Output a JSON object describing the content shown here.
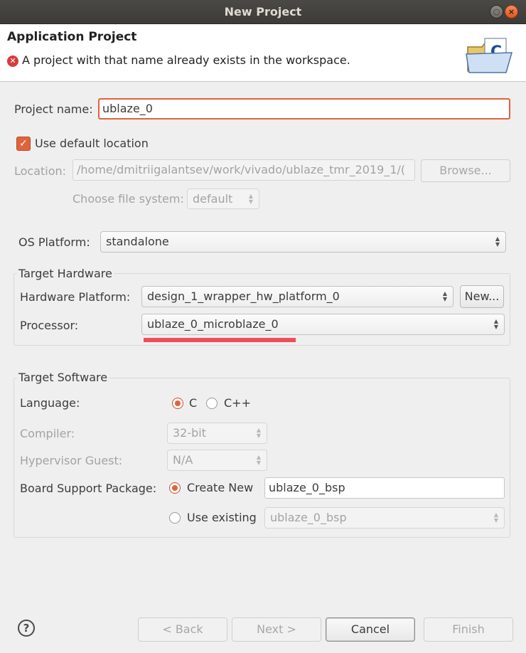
{
  "window": {
    "title": "New Project",
    "minimize_glyph": "○",
    "close_glyph": "×"
  },
  "banner": {
    "title": "Application Project",
    "error_message": "A project with that name already exists in the workspace.",
    "error_icon": "error-circle-icon",
    "wizard_icon": "c-project-folder-icon",
    "colors": {
      "error": "#d83b3b"
    }
  },
  "project": {
    "name_label": "Project name:",
    "name_value": "ublaze_0",
    "use_default_location_label": "Use default location",
    "use_default_location_checked": true,
    "location_label": "Location:",
    "location_value": "/home/dmitriigalantsev/work/vivado/ublaze_tmr_2019_1/(",
    "browse_label": "Browse...",
    "file_system_label": "Choose file system:",
    "file_system_value": "default"
  },
  "os": {
    "label": "OS Platform:",
    "value": "standalone"
  },
  "target_hardware": {
    "legend": "Target Hardware",
    "hw_platform_label": "Hardware Platform:",
    "hw_platform_value": "design_1_wrapper_hw_platform_0",
    "new_button": "New...",
    "processor_label": "Processor:",
    "processor_value": "ublaze_0_microblaze_0"
  },
  "target_software": {
    "legend": "Target Software",
    "language_label": "Language:",
    "language_options": [
      "C",
      "C++"
    ],
    "language_selected": "C",
    "compiler_label": "Compiler:",
    "compiler_value": "32-bit",
    "hypervisor_label": "Hypervisor Guest:",
    "hypervisor_value": "N/A",
    "bsp_label": "Board Support Package:",
    "bsp_create_new_label": "Create New",
    "bsp_create_new_value": "ublaze_0_bsp",
    "bsp_use_existing_label": "Use existing",
    "bsp_use_existing_value": "ublaze_0_bsp",
    "bsp_selected": "Create New"
  },
  "footer": {
    "help_glyph": "?",
    "back": "< Back",
    "next": "Next >",
    "cancel": "Cancel",
    "finish": "Finish"
  },
  "colors": {
    "accent": "#e0633b",
    "highlight_underline": "#ef4d5a"
  }
}
